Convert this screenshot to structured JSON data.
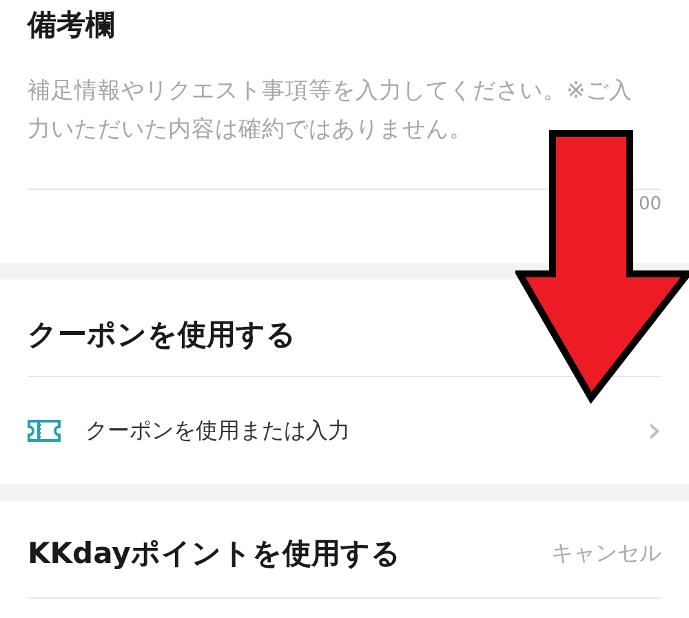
{
  "remarks": {
    "title": "備考欄",
    "placeholder": "補足情報やリクエスト事項等を入力してください。※ご入力いただいた内容は確約ではありません。",
    "counter": "00"
  },
  "coupon": {
    "title": "クーポンを使用する",
    "row_label": "クーポンを使用または入力",
    "chevron": "›"
  },
  "points": {
    "title": "KKdayポイントを使用する",
    "action": "キャンセル"
  }
}
